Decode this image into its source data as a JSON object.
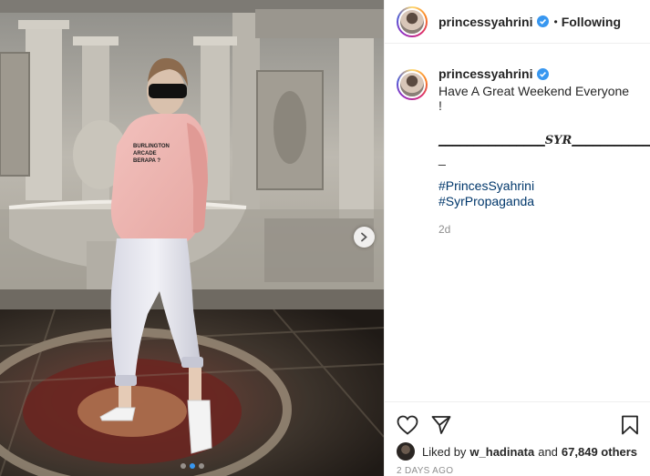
{
  "photo": {
    "alt": "Woman in pink hoodie and white cargo pants posing in a marble hall",
    "hoodie_text": "BURLINGTON ARCADE BERAPA ?",
    "carousel": {
      "count": 3,
      "active_index": 1
    }
  },
  "header": {
    "username": "princessyahrini",
    "separator": "•",
    "follow_label": "Following"
  },
  "caption": {
    "username": "princessyahrini",
    "text": "Have A Great Weekend Everyone !",
    "signature_left": "_______________",
    "signature_mark": "SYR",
    "signature_right": "_____________",
    "signature_dash": "_",
    "hashtags": [
      "#PrincesSyahrini",
      "#SyrPropaganda"
    ],
    "age": "2d"
  },
  "footer": {
    "likes_prefix": "Liked by",
    "liked_by_user": "w_hadinata",
    "likes_joiner": "and",
    "likes_others": "67,849 others",
    "date": "2 DAYS AGO"
  },
  "icons": {
    "like": "heart-icon",
    "share": "direct-share-icon",
    "save": "bookmark-icon",
    "verified": "verified-badge-icon",
    "next": "chevron-right-icon"
  },
  "colors": {
    "link": "#00376b",
    "verified": "#3897f0",
    "muted": "#8e8e8e",
    "text": "#262626"
  }
}
